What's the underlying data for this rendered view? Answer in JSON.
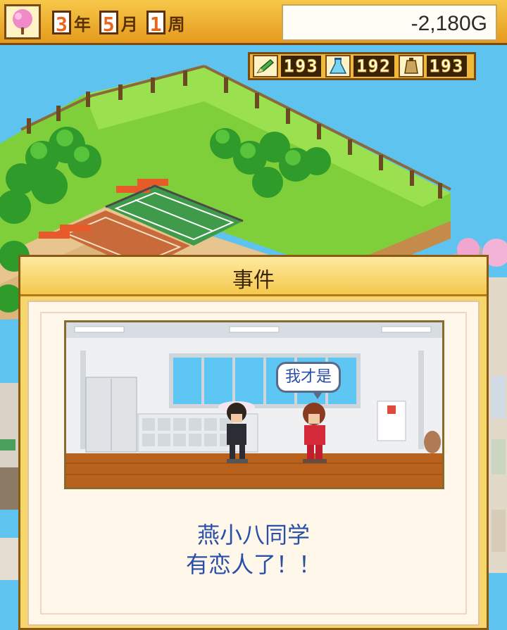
{
  "header": {
    "season_icon": "sakura-tree-icon",
    "date": {
      "year": "3",
      "year_unit": "年",
      "month": "5",
      "month_unit": "月",
      "week": "1",
      "week_unit": "周"
    },
    "money": "-2,180G"
  },
  "stats": [
    {
      "icon": "pencil-icon",
      "value": "193"
    },
    {
      "icon": "flask-icon",
      "value": "192"
    },
    {
      "icon": "weight-icon",
      "value": "193"
    }
  ],
  "dialog": {
    "title": "事件",
    "speech_bubble": "我才是",
    "message_line1": "燕小八同学",
    "message_line2": "有恋人了！！"
  },
  "colors": {
    "accent_orange": "#e8651a",
    "dialog_gold": "#f7d66b",
    "message_blue": "#2a4fa8"
  }
}
